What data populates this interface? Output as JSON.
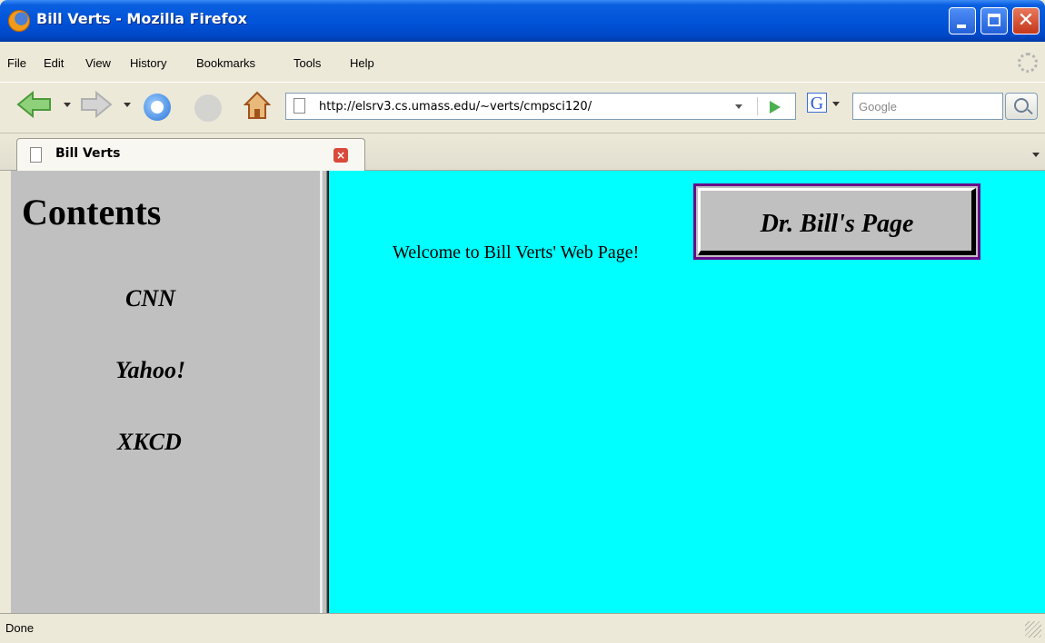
{
  "window": {
    "title": "Bill Verts - Mozilla Firefox"
  },
  "menu": [
    "File",
    "Edit",
    "View",
    "History",
    "Bookmarks",
    "Tools",
    "Help"
  ],
  "nav": {
    "url": "http://elsrv3.cs.umass.edu/~verts/cmpsci120/",
    "search_placeholder": "Google"
  },
  "tab": {
    "label": "Bill Verts"
  },
  "sidebar": {
    "heading": "Contents",
    "links": [
      "CNN",
      "Yahoo!",
      "XKCD"
    ]
  },
  "main": {
    "welcome": "Welcome to Bill Verts' Web Page!",
    "button_label": "Dr. Bill's Page"
  },
  "status": {
    "text": "Done"
  },
  "colors": {
    "content_bg": "#00ffff",
    "sidebar_bg": "#c0c0c0"
  },
  "icons": [
    "firefox-logo-icon",
    "back-arrow-icon",
    "forward-arrow-icon",
    "reload-icon",
    "stop-icon",
    "home-icon",
    "page-icon",
    "go-arrow-icon",
    "google-icon",
    "magnifier-icon",
    "close-icon",
    "throbber-icon"
  ]
}
